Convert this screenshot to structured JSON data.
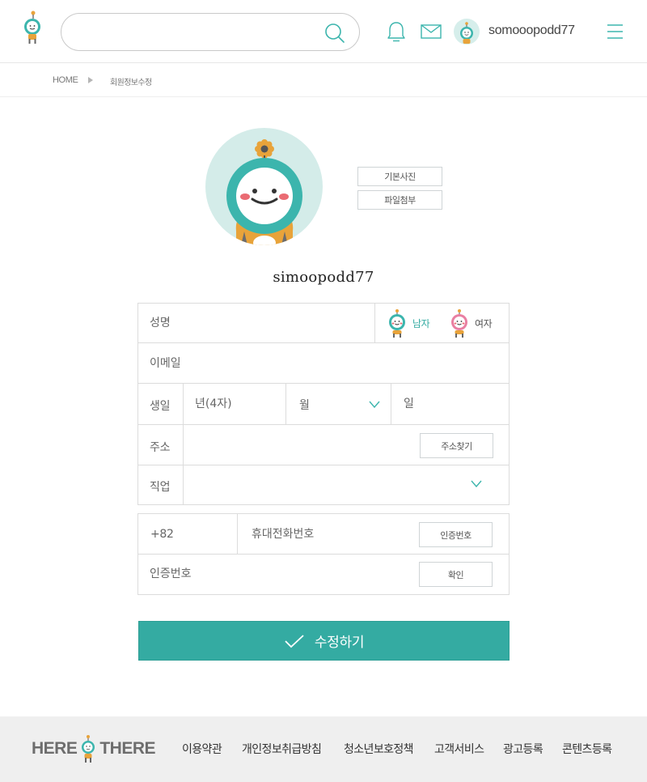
{
  "header": {
    "search": {
      "placeholder": "",
      "value": ""
    },
    "username": "somooopodd77"
  },
  "breadcrumb": {
    "home": "HOME",
    "current": "회원정보수정"
  },
  "profile": {
    "default_pic_label": "기본사진",
    "attach_label": "파일첨부",
    "name": "simoopodd77"
  },
  "form": {
    "name_label": "성명",
    "gender": {
      "male": "남자",
      "female": "여자",
      "selected": "male"
    },
    "email_label": "이메일",
    "birth": {
      "label": "생일",
      "year_placeholder": "년(4자)",
      "month_placeholder": "월",
      "day_placeholder": "일"
    },
    "address": {
      "label": "주소",
      "search_button": "주소찾기"
    },
    "job_label": "직업",
    "phone": {
      "country_code": "+82",
      "placeholder": "휴대전화번호",
      "verify_button": "인증번호"
    },
    "verify": {
      "label": "인증번호",
      "confirm_button": "확인"
    },
    "submit_label": "수정하기"
  },
  "footer": {
    "logo_left": "HERE",
    "logo_right": "THERE",
    "links": [
      "이용약관",
      "개인정보취급방침",
      "청소년보호정책",
      "고객서비스",
      "광고등록",
      "콘텐츠등록"
    ]
  },
  "colors": {
    "accent": "#34aba2",
    "teal_icon": "#3cb5ad",
    "orange": "#e8a33a",
    "pink": "#e97fa2"
  }
}
